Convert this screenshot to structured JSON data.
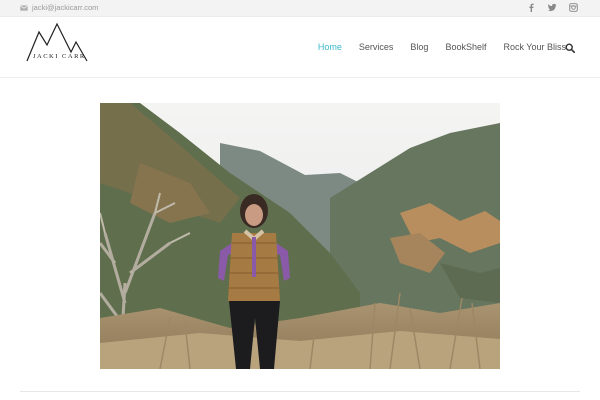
{
  "topbar": {
    "email": "jacki@jackicarr.com",
    "social": [
      "facebook-icon",
      "twitter-icon",
      "instagram-icon"
    ]
  },
  "logo": {
    "text": "JACKI CARR"
  },
  "nav": {
    "items": [
      "Home",
      "Services",
      "Blog",
      "BookShelf",
      "Rock Your Bliss"
    ],
    "active": "Home",
    "search_icon": "search-icon"
  },
  "colors": {
    "accent": "#3bb8c9",
    "topbar_bg": "#f3f3f3",
    "nav_text": "#555555"
  },
  "hero": {
    "alt": "woman-in-vest-on-hiking-trail"
  }
}
